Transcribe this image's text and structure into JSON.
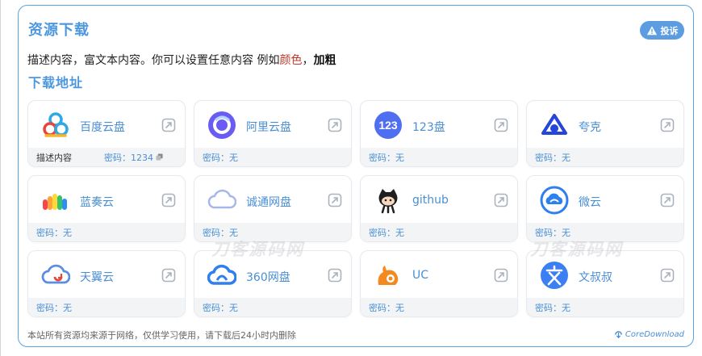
{
  "header": {
    "title": "资源下载",
    "report_label": "投诉"
  },
  "description": {
    "text_before": "描述内容，富文本内容。你可以设置任意内容 例如",
    "red_text": "颜色",
    "comma": "，",
    "bold_text": "加粗",
    "red_color": "#c0392b"
  },
  "downloads": {
    "title": "下载地址",
    "items": [
      {
        "name": "百度云盘",
        "icon": "baidu-cloud-icon",
        "note": "描述内容",
        "password": "密码：1234",
        "copy_icon": "copy-icon"
      },
      {
        "name": "阿里云盘",
        "icon": "aliyun-drive-icon",
        "password": "密码：无"
      },
      {
        "name": "123盘",
        "icon": "pan123-icon",
        "password": "密码：无"
      },
      {
        "name": "夸克",
        "icon": "quark-icon",
        "password": "密码：无"
      },
      {
        "name": "蓝奏云",
        "icon": "lanzou-icon",
        "password": "密码：无"
      },
      {
        "name": "诚通网盘",
        "icon": "ctfile-icon",
        "password": "密码：无"
      },
      {
        "name": "github",
        "icon": "github-icon",
        "password": "密码：无"
      },
      {
        "name": "微云",
        "icon": "weiyun-icon",
        "password": "密码：无"
      },
      {
        "name": "天翼云",
        "icon": "tianyi-cloud-icon",
        "password": "密码：无"
      },
      {
        "name": "360网盘",
        "icon": "pan360-icon",
        "password": "密码：无"
      },
      {
        "name": "UC",
        "icon": "uc-icon",
        "password": "密码：无"
      },
      {
        "name": "文叔叔",
        "icon": "wenshushu-icon",
        "password": "密码：无"
      }
    ]
  },
  "footer": {
    "notice": "本站所有资源均来源于网络，仅供学习使用，请下载后24小时内删除",
    "brand": "CoreDownload"
  },
  "watermarks": [
    "刀客源码网",
    "刀客源码网"
  ],
  "colors": {
    "accent": "#4d97de",
    "border": "#57a3e5",
    "link": "#4a8fd4"
  }
}
